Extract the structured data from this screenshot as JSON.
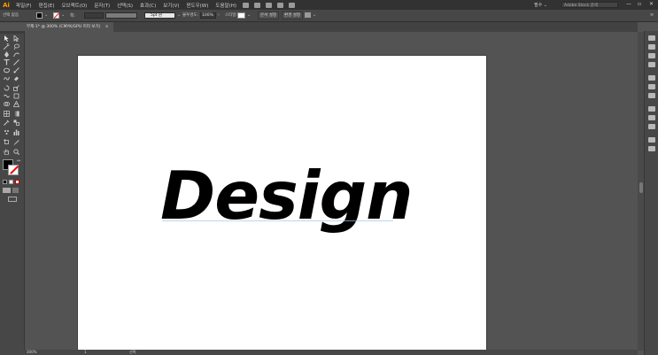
{
  "menubar": {
    "logo": "Ai",
    "items": [
      "파일(F)",
      "편집(E)",
      "오브젝트(O)",
      "문자(T)",
      "선택(S)",
      "효과(C)",
      "보기(V)",
      "윈도우(W)",
      "도움말(H)"
    ],
    "workspace": "필수 ⌄",
    "stock_search_placeholder": "Adobe Stock 검색",
    "minimize": "—",
    "maximize": "▫",
    "close": "✕"
  },
  "controlbar": {
    "selection_label": "선택 없음",
    "brush_definition": "5pt 원",
    "opacity_label": "불투명도:",
    "opacity_value": "100%",
    "style_label": "스타일:",
    "document_setup": "문서 설정",
    "preferences": "환경 설정"
  },
  "tab": {
    "title": "무제-1* @ 300% (CMYK/GPU 미리 보기)",
    "close": "×"
  },
  "canvas": {
    "artwork_text": "Design"
  },
  "statusbar": {
    "zoom": "300%",
    "artboard_number": "1",
    "tool_name": "선택"
  },
  "colors": {
    "chrome_dark": "#323232",
    "chrome": "#474747",
    "pasteboard": "#535353",
    "artboard": "#ffffff",
    "brand": "#ff9a00"
  }
}
